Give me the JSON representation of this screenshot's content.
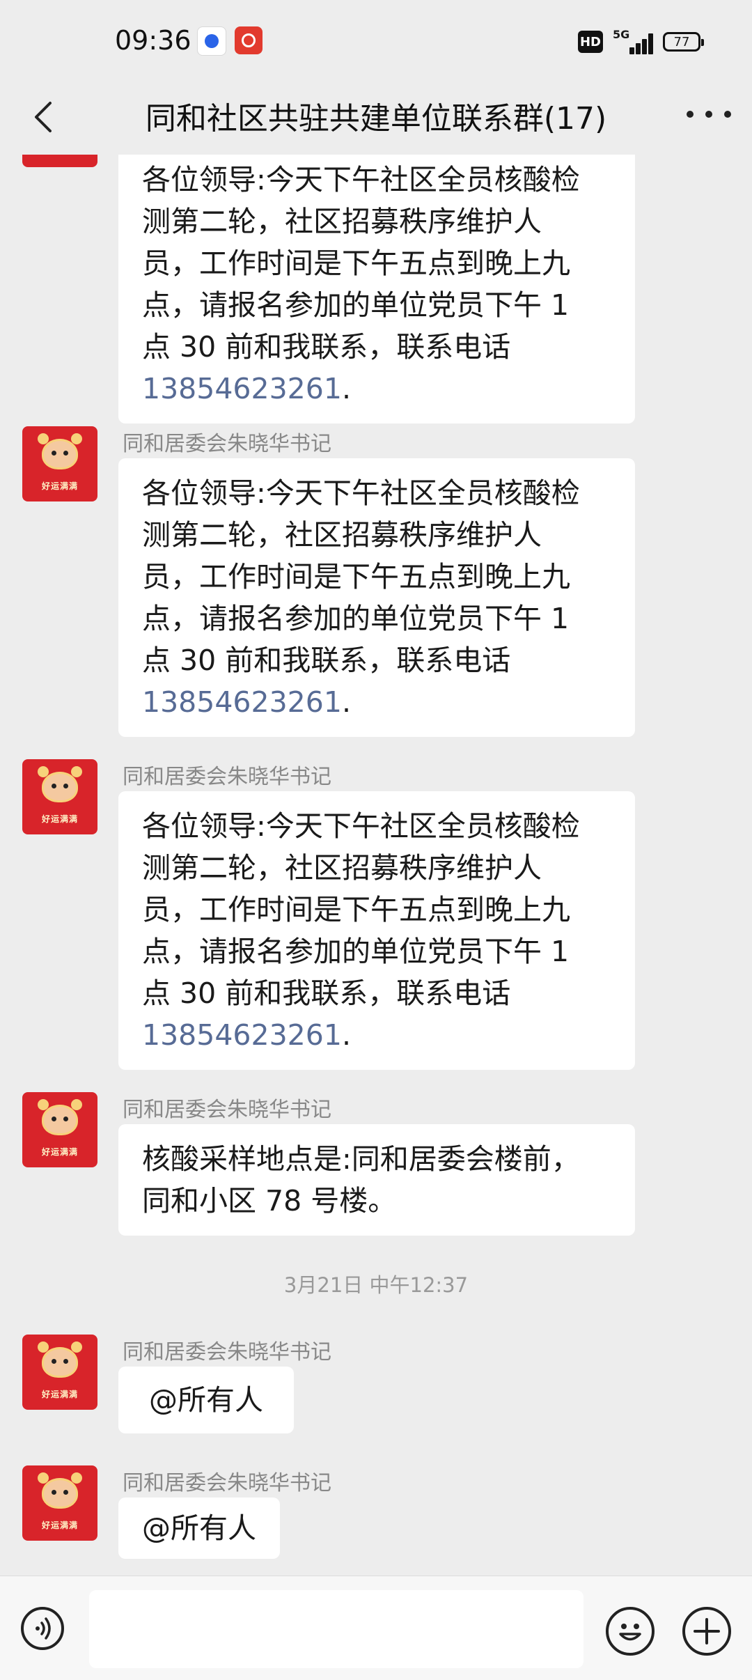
{
  "status_bar": {
    "time": "09:36",
    "network": "5G",
    "hd_label": "HD",
    "battery": "77",
    "app_icons": [
      "baidu-app-icon",
      "red-app-icon"
    ]
  },
  "header": {
    "title": "同和社区共驻共建单位联系群(17)",
    "back_icon": "chevron-left-icon",
    "more_icon": "more-horizontal-icon"
  },
  "avatar_caption": "好运满满",
  "messages": [
    {
      "sender": "",
      "lines": [
        "各位领导:今天下午社区全员核酸检",
        "测第二轮，社区招募秩序维护人",
        "员，工作时间是下午五点到晚上九",
        "点，请报名参加的单位党员下午 1",
        "点 30 前和我联系，联系电话"
      ],
      "phone": "13854623261",
      "phone_suffix": "."
    },
    {
      "sender": "同和居委会朱晓华书记",
      "lines": [
        "各位领导:今天下午社区全员核酸检",
        "测第二轮，社区招募秩序维护人",
        "员，工作时间是下午五点到晚上九",
        "点，请报名参加的单位党员下午 1",
        "点 30 前和我联系，联系电话"
      ],
      "phone": "13854623261",
      "phone_suffix": "."
    },
    {
      "sender": "同和居委会朱晓华书记",
      "lines": [
        "各位领导:今天下午社区全员核酸检",
        "测第二轮，社区招募秩序维护人",
        "员，工作时间是下午五点到晚上九",
        "点，请报名参加的单位党员下午 1",
        "点 30 前和我联系，联系电话"
      ],
      "phone": "13854623261",
      "phone_suffix": "."
    },
    {
      "sender": "同和居委会朱晓华书记",
      "lines": [
        "核酸采样地点是:同和居委会楼前，",
        "同和小区 78 号楼。"
      ]
    },
    {
      "sender": "同和居委会朱晓华书记",
      "lines": [
        "@所有人"
      ]
    },
    {
      "sender": "同和居委会朱晓华书记",
      "lines": [
        "@所有人"
      ]
    }
  ],
  "timestamp": "3月21日 中午12:37",
  "input_bar": {
    "voice_icon": "voice-icon",
    "input_value": "",
    "emoji_icon": "emoji-icon",
    "add_icon": "plus-icon"
  }
}
